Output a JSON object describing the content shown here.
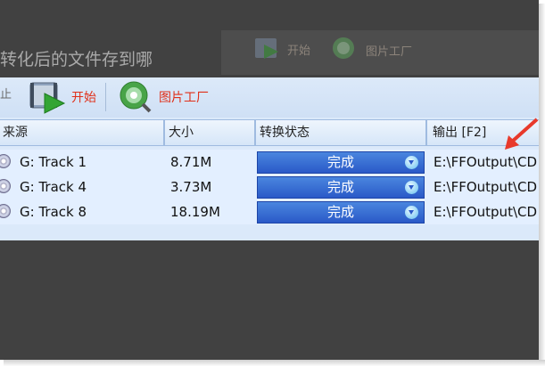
{
  "background": {
    "caption": "转化后的文件存到哪",
    "toolbar": {
      "start_label": "开始",
      "image_factory_label": "图片工厂"
    }
  },
  "toolbar": {
    "stop_fragment": "止",
    "start_label": "开始",
    "image_factory_label": "图片工厂"
  },
  "table": {
    "columns": [
      "来源",
      "大小",
      "转换状态",
      "输出 [F2]"
    ],
    "rows": [
      {
        "source": "G: Track 1",
        "size": "8.71M",
        "status": "完成",
        "output": "E:\\FFOutput\\CD"
      },
      {
        "source": "G: Track 4",
        "size": "3.73M",
        "status": "完成",
        "output": "E:\\FFOutput\\CD"
      },
      {
        "source": "G: Track 8",
        "size": "18.19M",
        "status": "完成",
        "output": "E:\\FFOutput\\CD"
      }
    ]
  },
  "colors": {
    "accent_arrow": "#e8392b",
    "status_blue": "#2f63cf",
    "label_red": "#e0301a"
  }
}
